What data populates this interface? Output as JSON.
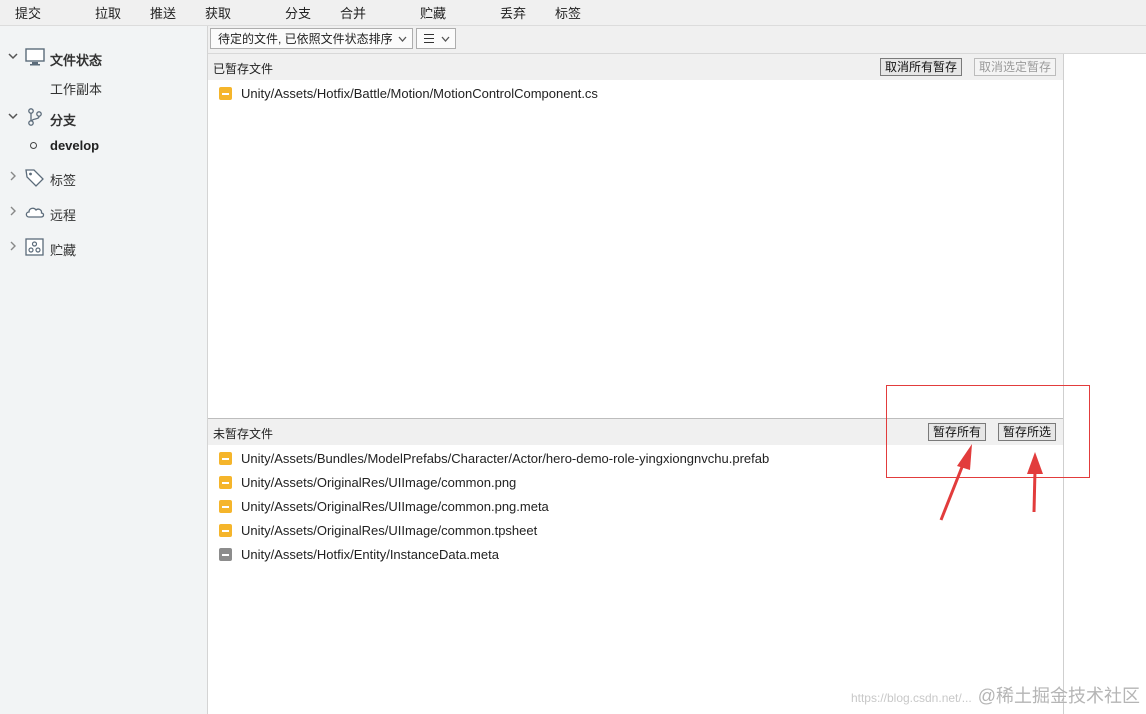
{
  "toolbar": {
    "items": [
      "提交",
      "拉取",
      "推送",
      "获取",
      "分支",
      "合并",
      "贮藏",
      "丢弃",
      "标签"
    ]
  },
  "sidebar": {
    "file_status": "文件状态",
    "working_copy": "工作副本",
    "branches": "分支",
    "current_branch": "develop",
    "tags": "标签",
    "remotes": "远程",
    "stashes": "贮藏"
  },
  "filter": {
    "sort_label": "待定的文件, 已依照文件状态排序"
  },
  "staged": {
    "title": "已暂存文件",
    "unstage_all": "取消所有暂存",
    "unstage_selected": "取消选定暂存",
    "files": [
      {
        "path": "Unity/Assets/Hotfix/Battle/Motion/MotionControlComponent.cs",
        "status": "modified"
      }
    ]
  },
  "unstaged": {
    "title": "未暂存文件",
    "stage_all": "暂存所有",
    "stage_selected": "暂存所选",
    "files": [
      {
        "path": "Unity/Assets/Bundles/ModelPrefabs/Character/Actor/hero-demo-role-yingxiongnvchu.prefab",
        "status": "modified"
      },
      {
        "path": "Unity/Assets/OriginalRes/UIImage/common.png",
        "status": "modified"
      },
      {
        "path": "Unity/Assets/OriginalRes/UIImage/common.png.meta",
        "status": "modified"
      },
      {
        "path": "Unity/Assets/OriginalRes/UIImage/common.tpsheet",
        "status": "modified"
      },
      {
        "path": "Unity/Assets/Hotfix/Entity/InstanceData.meta",
        "status": "deleted"
      }
    ]
  },
  "watermark": {
    "url": "https://blog.csdn.net/...",
    "text": "@稀土掘金技术社区"
  },
  "colors": {
    "modified": "#f5b52b",
    "deleted": "#8c8c8c",
    "annotation": "#e23c3c"
  }
}
